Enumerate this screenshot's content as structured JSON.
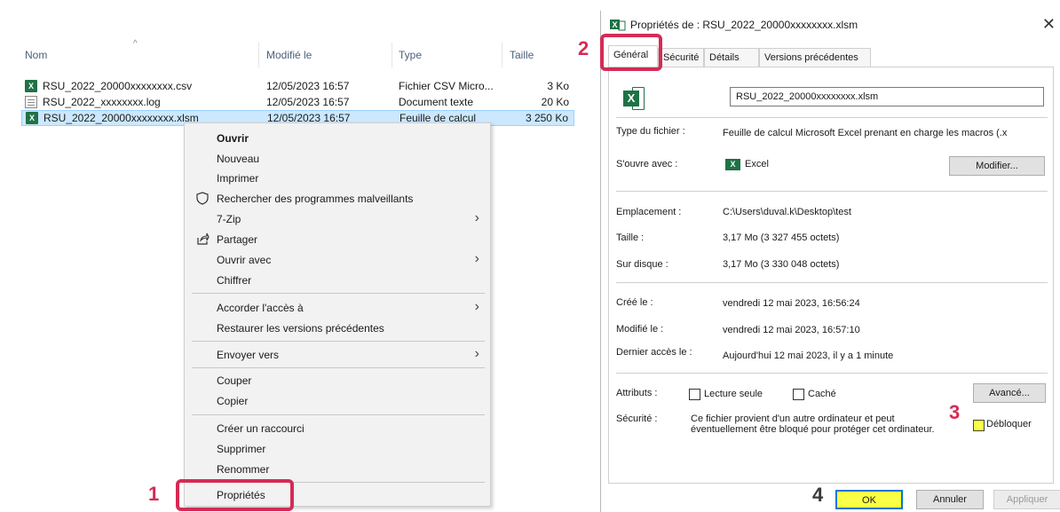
{
  "explorer": {
    "columns": {
      "name": "Nom",
      "modified": "Modifié le",
      "type": "Type",
      "size": "Taille"
    },
    "files": [
      {
        "name": "RSU_2022_20000xxxxxxxx.csv",
        "modified": "12/05/2023 16:57",
        "type": "Fichier CSV Micro...",
        "size": "3 Ko",
        "icon": "excel-csv-icon"
      },
      {
        "name": "RSU_2022_xxxxxxxx.log",
        "modified": "12/05/2023 16:57",
        "type": "Document texte",
        "size": "20 Ko",
        "icon": "text-file-icon"
      },
      {
        "name": "RSU_2022_20000xxxxxxxx.xlsm",
        "modified": "12/05/2023 16:57",
        "type": "Feuille de calcul",
        "size": "3 250 Ko",
        "icon": "excel-macro-icon",
        "selected": true
      }
    ]
  },
  "context_menu": {
    "items": {
      "open": "Ouvrir",
      "new": "Nouveau",
      "print": "Imprimer",
      "scan": "Rechercher des programmes malveillants",
      "zip": "7-Zip",
      "share": "Partager",
      "open_with": "Ouvrir avec",
      "encrypt": "Chiffrer",
      "grant_access": "Accorder l'accès à",
      "restore": "Restaurer les versions précédentes",
      "send_to": "Envoyer vers",
      "cut": "Couper",
      "copy": "Copier",
      "shortcut": "Créer un raccourci",
      "delete": "Supprimer",
      "rename": "Renommer",
      "properties": "Propriétés"
    }
  },
  "steps": {
    "s1": "1",
    "s2": "2",
    "s3": "3",
    "s4": "4"
  },
  "dialog": {
    "title": "Propriétés de : RSU_2022_20000xxxxxxxx.xlsm",
    "tabs": {
      "general": "Général",
      "security": "Sécurité",
      "details": "Détails",
      "previous": "Versions précédentes"
    },
    "file_name": "RSU_2022_20000xxxxxxxx.xlsm",
    "labels": {
      "file_type": "Type du fichier :",
      "opens_with": "S'ouvre avec :",
      "location": "Emplacement :",
      "size": "Taille :",
      "size_on_disk": "Sur disque :",
      "created": "Créé le :",
      "modified": "Modifié le :",
      "accessed": "Dernier accès le :",
      "attributes": "Attributs :",
      "security": "Sécurité :"
    },
    "values": {
      "file_type": "Feuille de calcul Microsoft Excel prenant en charge les macros (.x",
      "opens_with": "Excel",
      "location": "C:\\Users\\duval.k\\Desktop\\test",
      "size": "3,17 Mo (3 327 455 octets)",
      "size_on_disk": "3,17 Mo (3 330 048 octets)",
      "created": "vendredi 12 mai 2023, 16:56:24",
      "modified": "vendredi 12 mai 2023, 16:57:10",
      "accessed": "Aujourd'hui 12 mai 2023, il y a 1 minute",
      "security_line1": "Ce fichier provient d'un autre ordinateur et peut",
      "security_line2": "éventuellement être bloqué pour protéger cet ordinateur."
    },
    "attributes": {
      "read_only": "Lecture seule",
      "hidden": "Caché",
      "unblock": "Débloquer"
    },
    "buttons": {
      "change": "Modifier...",
      "advanced": "Avancé...",
      "ok": "OK",
      "cancel": "Annuler",
      "apply": "Appliquer"
    }
  },
  "colors": {
    "highlight": "#d52b55",
    "selection": "#cce8ff",
    "excel": "#1f7246",
    "marker": "#fbff45"
  }
}
